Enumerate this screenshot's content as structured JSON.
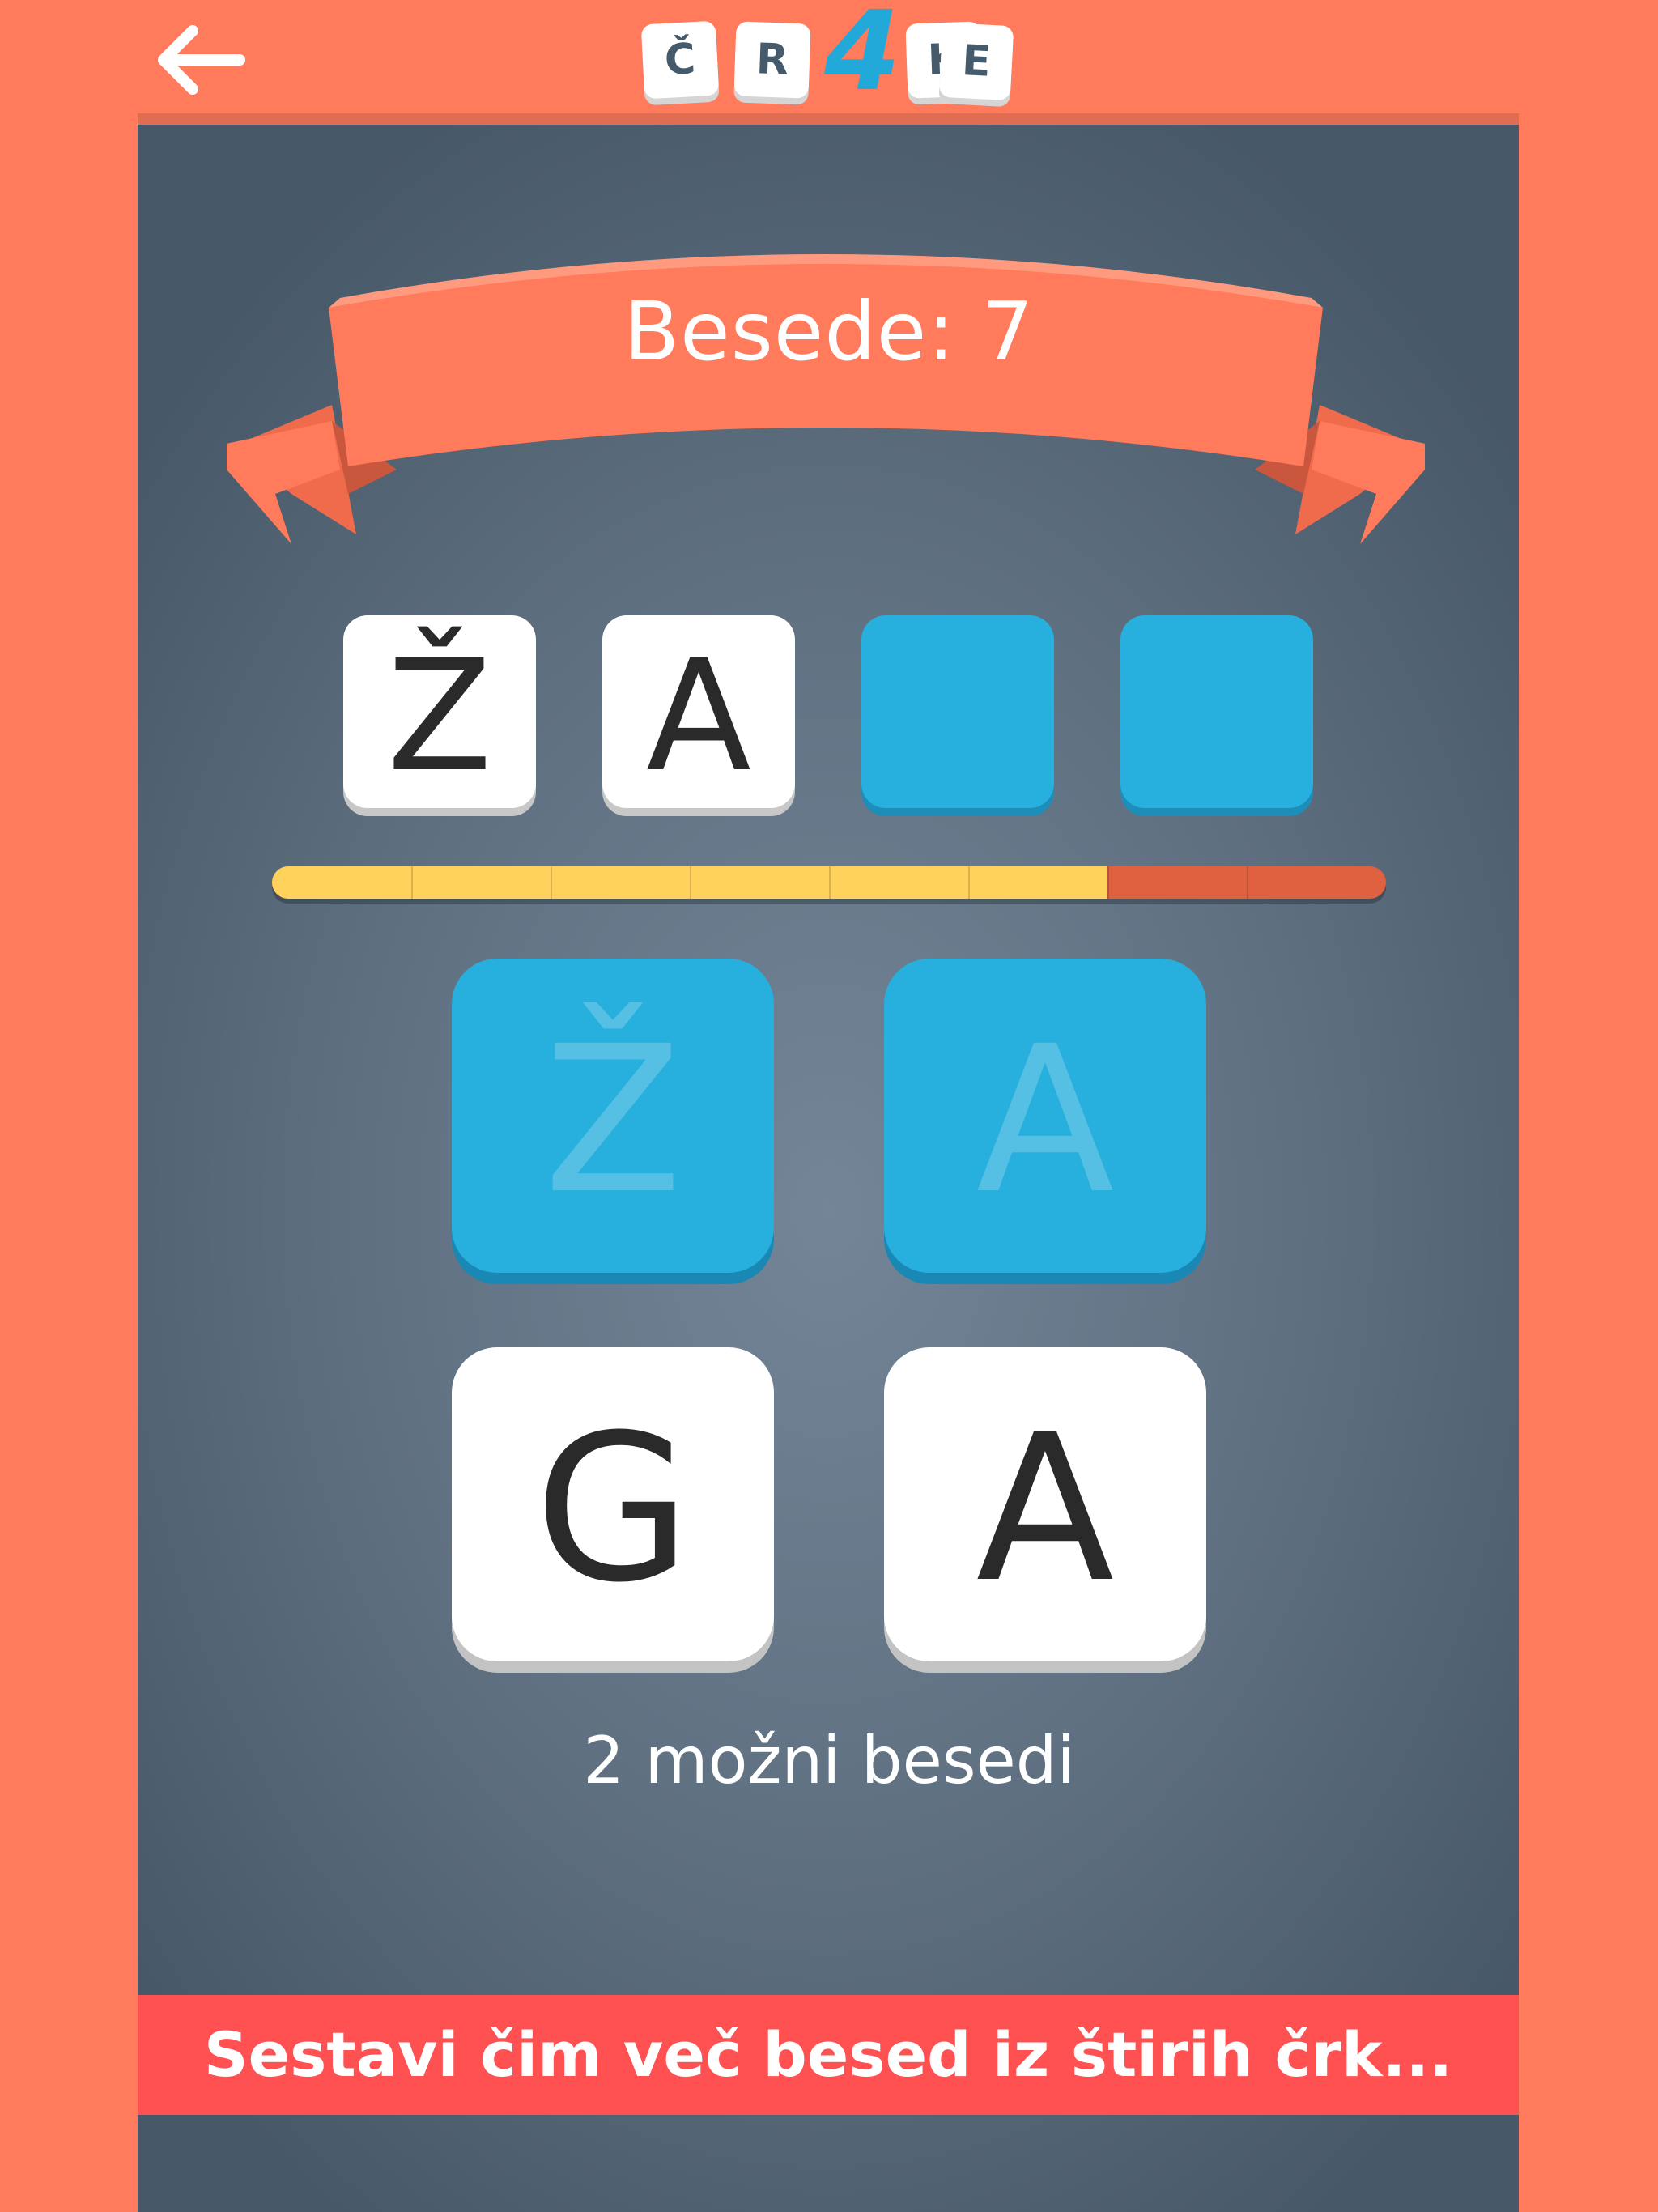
{
  "header": {
    "back_icon": "arrow-left-icon",
    "logo_letters": [
      "Č",
      "R",
      "4",
      "K",
      "E"
    ]
  },
  "banner": {
    "label": "Besede: 7"
  },
  "answer": {
    "slots": [
      {
        "letter": "Ž",
        "state": "filled"
      },
      {
        "letter": "A",
        "state": "filled"
      },
      {
        "letter": "",
        "state": "empty"
      },
      {
        "letter": "",
        "state": "empty"
      }
    ]
  },
  "progress": {
    "segments_total": 8,
    "segments_filled": 6
  },
  "tiles": [
    {
      "letter": "Ž",
      "state": "used"
    },
    {
      "letter": "A",
      "state": "used"
    },
    {
      "letter": "G",
      "state": "free"
    },
    {
      "letter": "A",
      "state": "free"
    }
  ],
  "hint": "2 možni besedi",
  "instruction": "Sestavi čim več besed iz štirih črk...",
  "colors": {
    "background": "#FF7B5C",
    "panel": "#5E6F80",
    "accent_blue": "#27AFDD",
    "banner": "#FF7B5C",
    "progress_fill": "#FFD25C",
    "progress_empty": "#E0613F",
    "instruction_bar": "#FF5152"
  }
}
